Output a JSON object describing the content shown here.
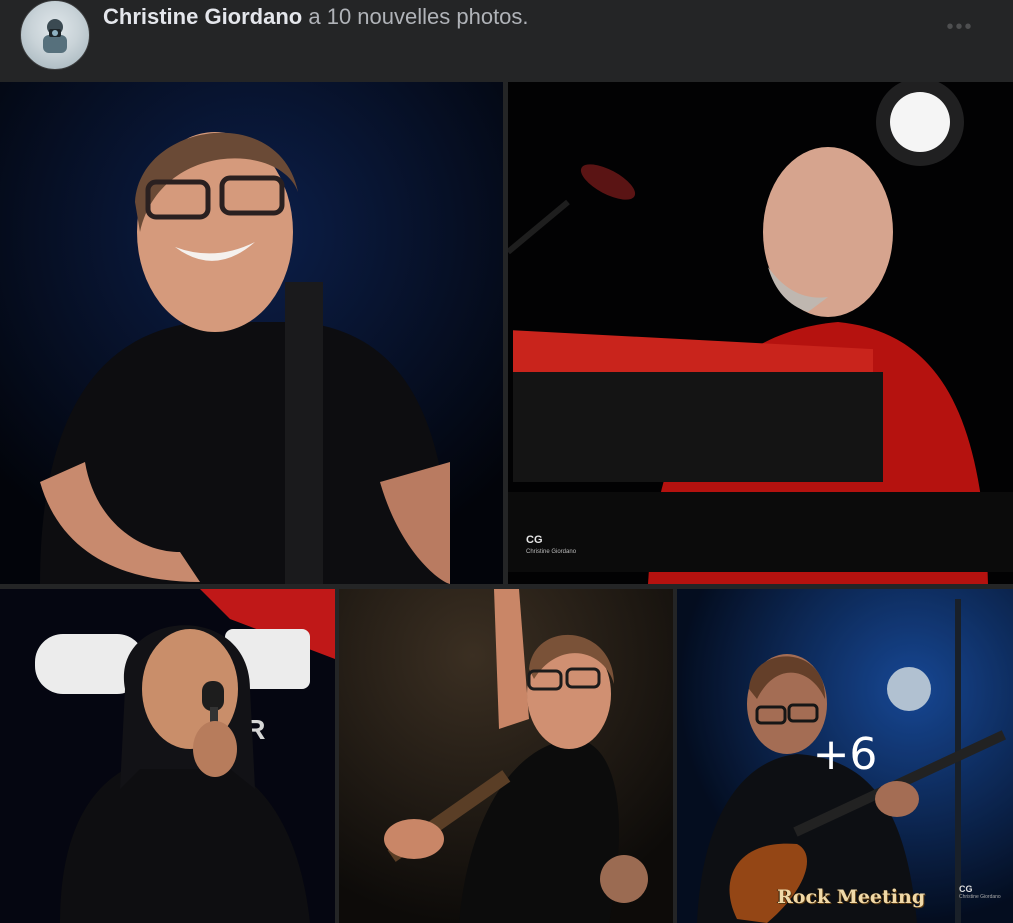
{
  "post": {
    "author": "Christine Giordano",
    "action": " a 10 nouvelles photos.",
    "more_label": "•••"
  },
  "photos": [
    {
      "name": "photo-guitarist-smiling"
    },
    {
      "name": "photo-keyboardist-red-shirt"
    },
    {
      "name": "photo-singer-microphone"
    },
    {
      "name": "photo-guitarist-arm-raised"
    },
    {
      "name": "photo-guitarist-playing",
      "more_count": "+6"
    }
  ],
  "watermarks": {
    "cg": "CG",
    "cg_name": "Christine Giordano",
    "rock_meeting": "Rock Meeting"
  },
  "colors": {
    "background": "#242526",
    "author_text": "#e4e6eb",
    "secondary_text": "#b0b3b8"
  }
}
